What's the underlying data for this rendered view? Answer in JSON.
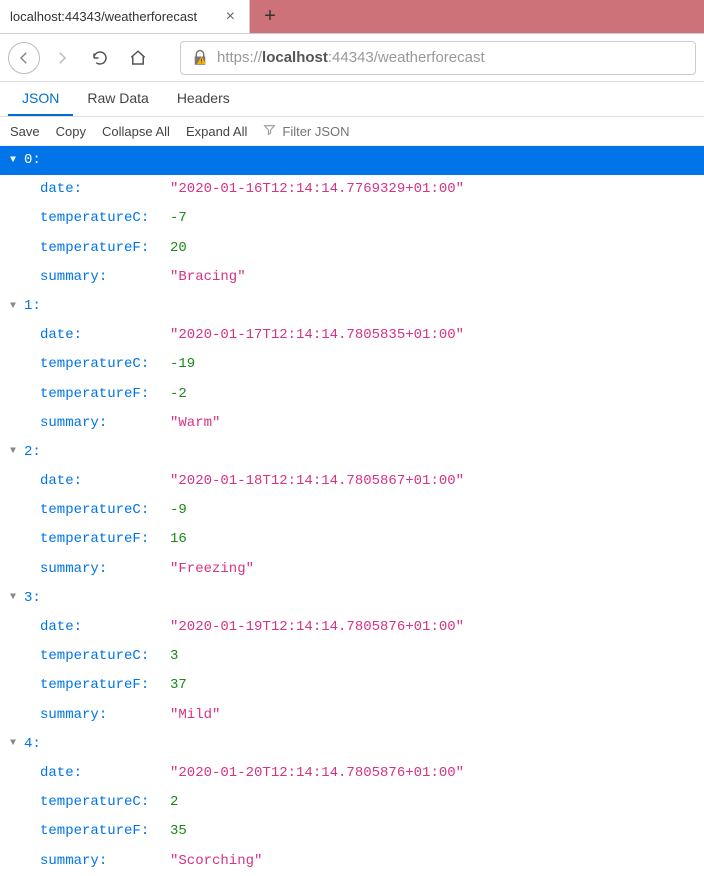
{
  "tab": {
    "title": "localhost:44343/weatherforecast"
  },
  "url": {
    "prefix": "https://",
    "host": "localhost",
    "suffix": ":44343/weatherforecast"
  },
  "view_tabs": {
    "json": "JSON",
    "raw": "Raw Data",
    "headers": "Headers"
  },
  "actions": {
    "save": "Save",
    "copy": "Copy",
    "collapse": "Collapse All",
    "expand": "Expand All"
  },
  "filter": {
    "placeholder": "Filter JSON"
  },
  "indices": {
    "i0": "0:",
    "i1": "1:",
    "i2": "2:",
    "i3": "3:",
    "i4": "4:"
  },
  "entries": [
    {
      "date": "\"2020-01-16T12:14:14.7769329+01:00\"",
      "tc": "-7",
      "tf": "20",
      "summary": "\"Bracing\""
    },
    {
      "date": "\"2020-01-17T12:14:14.7805835+01:00\"",
      "tc": "-19",
      "tf": "-2",
      "summary": "\"Warm\""
    },
    {
      "date": "\"2020-01-18T12:14:14.7805867+01:00\"",
      "tc": "-9",
      "tf": "16",
      "summary": "\"Freezing\""
    },
    {
      "date": "\"2020-01-19T12:14:14.7805876+01:00\"",
      "tc": "3",
      "tf": "37",
      "summary": "\"Mild\""
    },
    {
      "date": "\"2020-01-20T12:14:14.7805876+01:00\"",
      "tc": "2",
      "tf": "35",
      "summary": "\"Scorching\""
    }
  ],
  "keys": {
    "date": "date",
    "tc": "temperatureC",
    "tf": "temperatureF",
    "summary": "summary"
  }
}
